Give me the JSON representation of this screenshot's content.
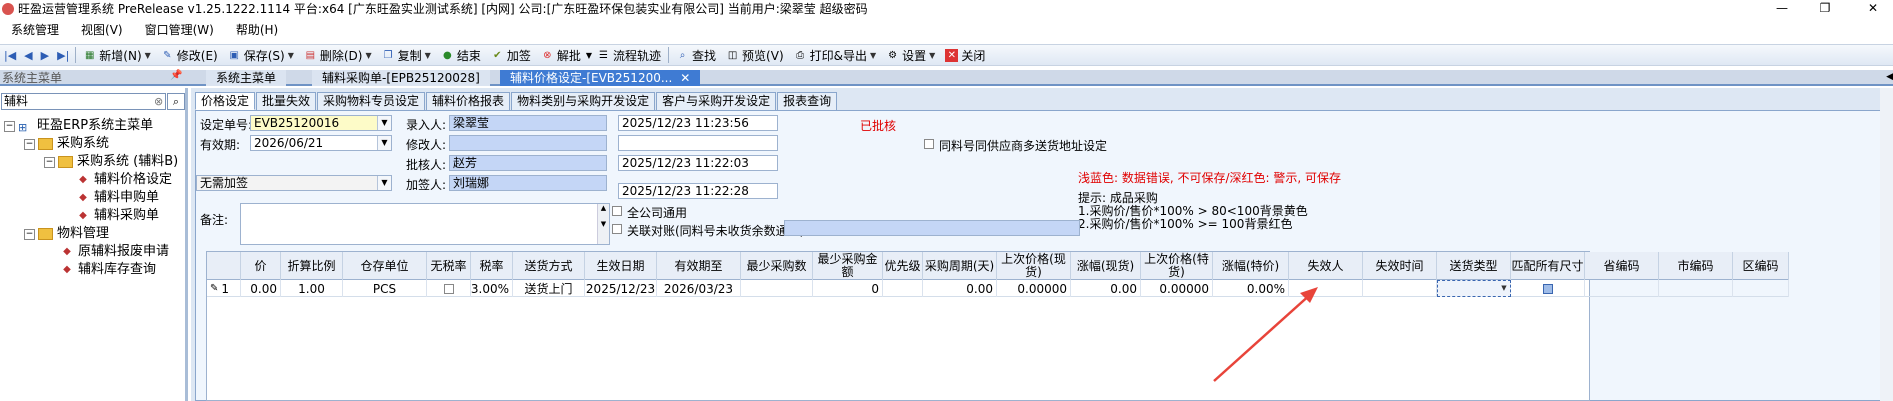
{
  "window": {
    "title": "旺盈运营管理系统 PreRelease v1.25.1222.1114 平台:x64 [广东旺盈实业测试系统] [内网] 公司:[广东旺盈环保包装实业有限公司] 当前用户:梁翠莹 超级密码",
    "minimize": "—",
    "restore": "❐",
    "close": "✕"
  },
  "menu": [
    "系统管理",
    "视图(V)",
    "窗口管理(W)",
    "帮助(H)"
  ],
  "toolbar": {
    "new": "新增(N)",
    "edit": "修改(E)",
    "save": "保存(S)",
    "delete": "删除(D)",
    "copy": "复制",
    "finish": "结束",
    "sign": "加签",
    "unapprove": "解批",
    "flow": "流程轨迹",
    "find": "查找",
    "preview": "预览(V)",
    "print": "打印&导出",
    "settings": "设置",
    "close": "关闭"
  },
  "tabs": {
    "sys_title": "系统主菜单",
    "items": [
      {
        "label": "系统主菜单"
      },
      {
        "label": "辅料采购单-[EPB25120028]"
      },
      {
        "label": "辅料价格设定-[EVB25120016]",
        "display": "辅料价格设定-[EVB251200..."
      }
    ]
  },
  "sidebar": {
    "search_value": "辅料",
    "tree": {
      "root": "旺盈ERP系统主菜单",
      "purchase": "采购系统",
      "purchase_aux": "采购系统 (辅料B)",
      "aux_price": "辅料价格设定",
      "aux_request": "辅料申购单",
      "aux_po": "辅料采购单",
      "material_mgmt": "物料管理",
      "aux_scrap": "原辅料报废申请",
      "aux_stock": "辅料库存查询"
    }
  },
  "subtabs": [
    "价格设定",
    "批量失效",
    "采购物料专员设定",
    "辅料价格报表",
    "物料类别与采购开发设定",
    "客户与采购开发设定",
    "报表查询"
  ],
  "form": {
    "setting_no_label": "设定单号:",
    "setting_no": "EVB25120016",
    "valid_label": "有效期:",
    "valid_date": "2026/06/21",
    "sign_type": "无需加签",
    "note_label": "备注:",
    "entry_label": "录入人:",
    "entry_person": "梁翠莹",
    "entry_time": "2025/12/23 11:23:56",
    "modify_label": "修改人:",
    "modify_person": "",
    "modify_time": "",
    "approve_label": "批核人:",
    "approve_person": "赵芳",
    "approve_time": "2025/12/23 11:22:03",
    "sign_label": "加签人:",
    "sign_person": "刘瑞娜",
    "sign_time": "2025/12/23 11:22:28",
    "status": "已批核",
    "multi_addr": "同料号同供应商多送货地址设定",
    "all_company": "全公司通用",
    "related_account": "关联对账(同料号未收货余数通用)",
    "color_legend": "浅蓝色: 数据错误, 不可保存/深红色: 警示, 可保存",
    "hint_title": "提示: 成品采购",
    "hint_1": "1.采购价/售价*100% > 80<100背景黄色",
    "hint_2": "2.采购价/售价*100% >= 100背景红色"
  },
  "grid": {
    "columns": [
      "价",
      "折算比例",
      "仓存单位",
      "无税率",
      "税率",
      "送货方式",
      "生效日期",
      "有效期至",
      "最少采购数",
      "最少采购金额",
      "优先级",
      "采购周期(天)",
      "上次价格(现货)",
      "涨幅(现货)",
      "上次价格(特货)",
      "涨幅(特价)",
      "失效人",
      "失效时间",
      "送货类型",
      "匹配所有尺寸",
      "省编码",
      "市编码",
      "区编码"
    ],
    "rows": [
      {
        "index": "1",
        "price": "0.00",
        "ratio": "1.00",
        "unit": "PCS",
        "tax_free": false,
        "tax_rate": "3.00%",
        "delivery": "送货上门",
        "start_date": "2025/12/23",
        "end_date": "2026/03/23",
        "min_qty": "",
        "min_amount": "0",
        "priority": "",
        "cycle": "0.00",
        "last_price_spot": "0.00000",
        "rise_spot": "0.00",
        "last_price_special": "0.00000",
        "rise_special": "0.00%",
        "invalid_by": "",
        "invalid_time": "",
        "delivery_type": "",
        "match_all": true,
        "province": "",
        "city": "",
        "district": ""
      }
    ]
  },
  "colors": {
    "accent": "#3f7bd3",
    "status_red": "#e00000",
    "field_blue": "#c4d6f6",
    "field_yellow": "#fdfbc8",
    "arrow": "#e8443a"
  }
}
